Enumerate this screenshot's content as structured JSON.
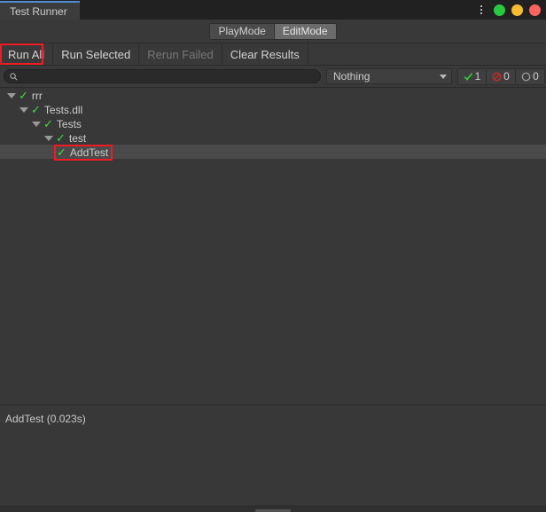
{
  "window": {
    "tab_title": "Test Runner",
    "controls": {
      "menu_icon": "kebab-menu-icon",
      "minimize_color": "#28c840",
      "maximize_color": "#f5bd2f",
      "close_color": "#f9655e"
    }
  },
  "modes": {
    "playmode_label": "PlayMode",
    "editmode_label": "EditMode",
    "active": "EditMode"
  },
  "toolbar": {
    "run_all_label": "Run All",
    "run_selected_label": "Run Selected",
    "rerun_failed_label": "Rerun Failed",
    "clear_results_label": "Clear Results"
  },
  "search": {
    "icon": "search-icon",
    "value": "",
    "placeholder": ""
  },
  "filter": {
    "selected_option": "Nothing",
    "caret_icon": "chevron-down-icon"
  },
  "counters": {
    "passed": {
      "icon": "check-icon",
      "count": "1",
      "color": "#3ddc46"
    },
    "failed": {
      "icon": "circle-slash-icon",
      "count": "0",
      "color": "#c82a2a"
    },
    "not_run": {
      "icon": "circle-outline-icon",
      "count": "0",
      "color": "#9a9a9a"
    }
  },
  "tree": [
    {
      "label": "rrr",
      "depth": 0,
      "status_icon": "check-icon",
      "expanded": true,
      "has_toggle": true,
      "selected": false
    },
    {
      "label": "Tests.dll",
      "depth": 1,
      "status_icon": "check-icon",
      "expanded": true,
      "has_toggle": true,
      "selected": false
    },
    {
      "label": "Tests",
      "depth": 2,
      "status_icon": "check-icon",
      "expanded": true,
      "has_toggle": true,
      "selected": false
    },
    {
      "label": "test",
      "depth": 3,
      "status_icon": "check-icon",
      "expanded": true,
      "has_toggle": true,
      "selected": false
    },
    {
      "label": "AddTest",
      "depth": 4,
      "status_icon": "check-icon",
      "expanded": false,
      "has_toggle": false,
      "selected": true
    }
  ],
  "results": {
    "detail_text": "AddTest (0.023s)"
  },
  "annotations": {
    "color": "#ee1c24",
    "boxes": [
      "run-all-button",
      "tree-item-addtest"
    ]
  }
}
